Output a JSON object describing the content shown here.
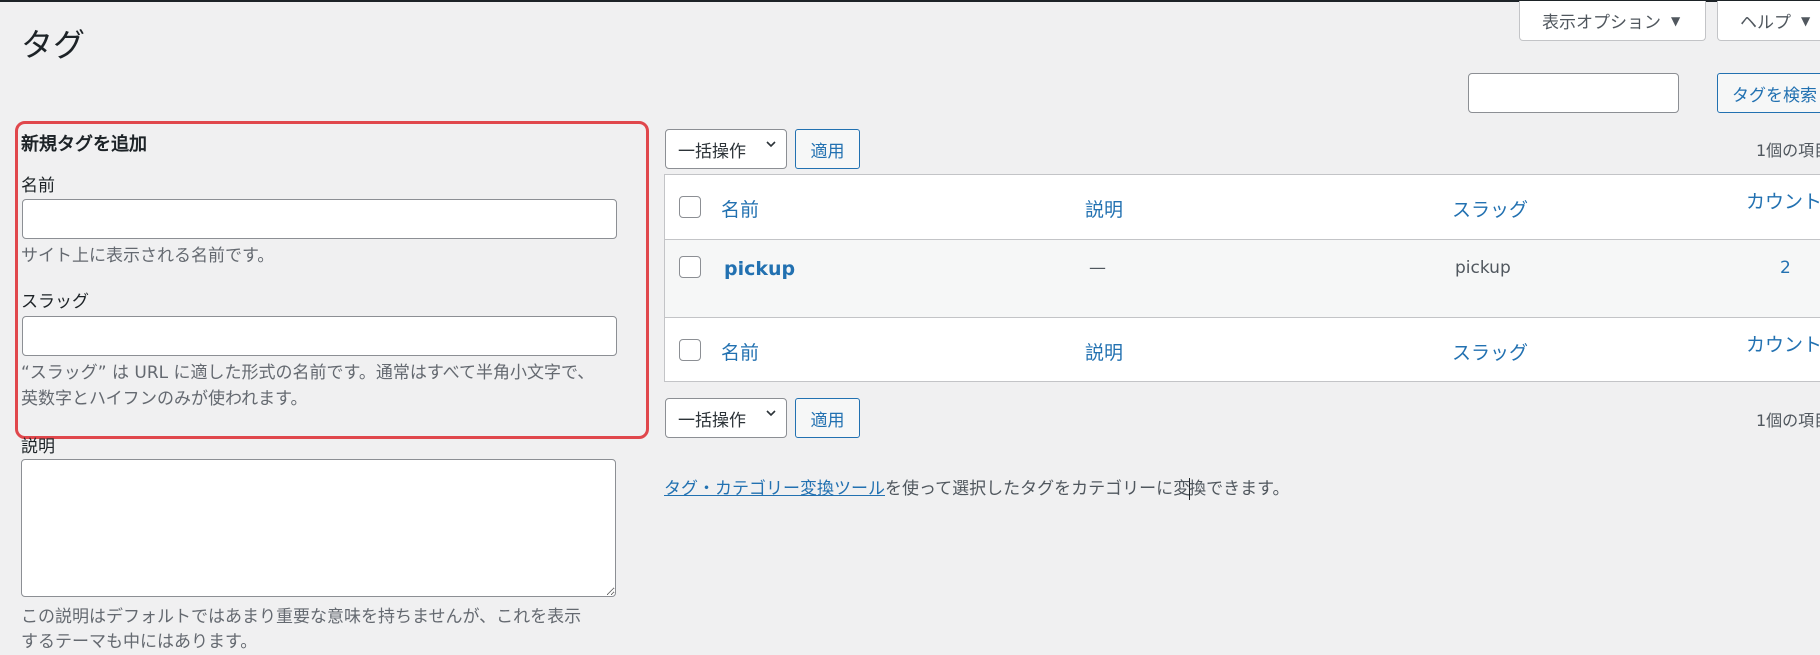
{
  "page": {
    "title": "タグ"
  },
  "screen_tabs": {
    "options": "表示オプション",
    "help": "ヘルプ"
  },
  "search": {
    "button": "タグを検索",
    "value": ""
  },
  "add_form": {
    "heading": "新規タグを追加",
    "name_label": "名前",
    "name_value": "",
    "name_help": "サイト上に表示される名前です。",
    "slug_label": "スラッグ",
    "slug_value": "",
    "slug_help_line1": "“スラッグ” は URL に適した形式の名前です。通常はすべて半角小文字で、",
    "slug_help_line2": "英数字とハイフンのみが使われます。",
    "desc_label": "説明",
    "desc_help_line1": "この説明はデフォルトではあまり重要な意味を持ちませんが、これを表示",
    "desc_help_line2": "するテーマも中にはあります。"
  },
  "bulk": {
    "select_label": "一括操作",
    "apply_label": "適用",
    "items_count": "1個の項目"
  },
  "table": {
    "columns": {
      "name": "名前",
      "description": "説明",
      "slug": "スラッグ",
      "count": "カウント"
    },
    "rows": [
      {
        "name": "pickup",
        "description": "—",
        "slug": "pickup",
        "count": "2"
      }
    ]
  },
  "footer": {
    "link": "タグ・カテゴリー変換ツール",
    "text_before_caret": "を使って選択したタグをカテゴリーに変",
    "text_after_caret": "換できます。"
  },
  "colors": {
    "accent": "#2271b1",
    "highlight": "#e0474c",
    "background": "#f0f0f1"
  }
}
